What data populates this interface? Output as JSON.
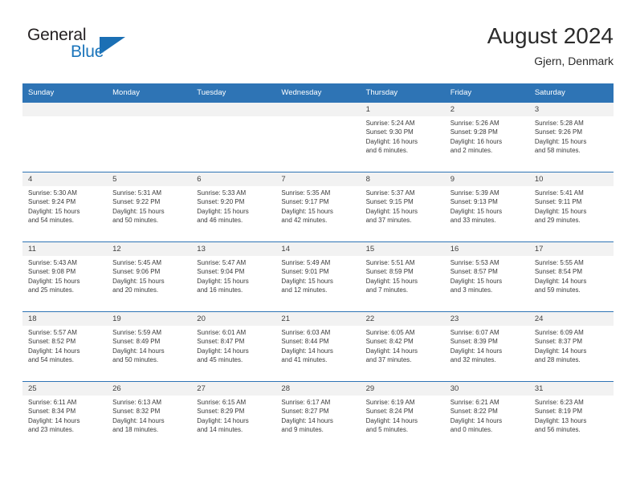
{
  "brand": {
    "word1": "General",
    "word2": "Blue",
    "logo_icon": "blue-triangle-icon",
    "accent_color": "#1b75bb"
  },
  "header": {
    "title": "August 2024",
    "subtitle": "Gjern, Denmark"
  },
  "theme": {
    "header_blue": "#2e74b5",
    "day_band_gray": "#f2f2f2"
  },
  "weekdays": [
    "Sunday",
    "Monday",
    "Tuesday",
    "Wednesday",
    "Thursday",
    "Friday",
    "Saturday"
  ],
  "labels": {
    "sunrise_prefix": "Sunrise:",
    "sunset_prefix": "Sunset:",
    "daylight_prefix": "Daylight:"
  },
  "weeks": [
    [
      {
        "empty": true
      },
      {
        "empty": true
      },
      {
        "empty": true
      },
      {
        "empty": true
      },
      {
        "day": "1",
        "sunrise": "Sunrise: 5:24 AM",
        "sunset": "Sunset: 9:30 PM",
        "daylight1": "Daylight: 16 hours",
        "daylight2": "and 6 minutes."
      },
      {
        "day": "2",
        "sunrise": "Sunrise: 5:26 AM",
        "sunset": "Sunset: 9:28 PM",
        "daylight1": "Daylight: 16 hours",
        "daylight2": "and 2 minutes."
      },
      {
        "day": "3",
        "sunrise": "Sunrise: 5:28 AM",
        "sunset": "Sunset: 9:26 PM",
        "daylight1": "Daylight: 15 hours",
        "daylight2": "and 58 minutes."
      }
    ],
    [
      {
        "day": "4",
        "sunrise": "Sunrise: 5:30 AM",
        "sunset": "Sunset: 9:24 PM",
        "daylight1": "Daylight: 15 hours",
        "daylight2": "and 54 minutes."
      },
      {
        "day": "5",
        "sunrise": "Sunrise: 5:31 AM",
        "sunset": "Sunset: 9:22 PM",
        "daylight1": "Daylight: 15 hours",
        "daylight2": "and 50 minutes."
      },
      {
        "day": "6",
        "sunrise": "Sunrise: 5:33 AM",
        "sunset": "Sunset: 9:20 PM",
        "daylight1": "Daylight: 15 hours",
        "daylight2": "and 46 minutes."
      },
      {
        "day": "7",
        "sunrise": "Sunrise: 5:35 AM",
        "sunset": "Sunset: 9:17 PM",
        "daylight1": "Daylight: 15 hours",
        "daylight2": "and 42 minutes."
      },
      {
        "day": "8",
        "sunrise": "Sunrise: 5:37 AM",
        "sunset": "Sunset: 9:15 PM",
        "daylight1": "Daylight: 15 hours",
        "daylight2": "and 37 minutes."
      },
      {
        "day": "9",
        "sunrise": "Sunrise: 5:39 AM",
        "sunset": "Sunset: 9:13 PM",
        "daylight1": "Daylight: 15 hours",
        "daylight2": "and 33 minutes."
      },
      {
        "day": "10",
        "sunrise": "Sunrise: 5:41 AM",
        "sunset": "Sunset: 9:11 PM",
        "daylight1": "Daylight: 15 hours",
        "daylight2": "and 29 minutes."
      }
    ],
    [
      {
        "day": "11",
        "sunrise": "Sunrise: 5:43 AM",
        "sunset": "Sunset: 9:08 PM",
        "daylight1": "Daylight: 15 hours",
        "daylight2": "and 25 minutes."
      },
      {
        "day": "12",
        "sunrise": "Sunrise: 5:45 AM",
        "sunset": "Sunset: 9:06 PM",
        "daylight1": "Daylight: 15 hours",
        "daylight2": "and 20 minutes."
      },
      {
        "day": "13",
        "sunrise": "Sunrise: 5:47 AM",
        "sunset": "Sunset: 9:04 PM",
        "daylight1": "Daylight: 15 hours",
        "daylight2": "and 16 minutes."
      },
      {
        "day": "14",
        "sunrise": "Sunrise: 5:49 AM",
        "sunset": "Sunset: 9:01 PM",
        "daylight1": "Daylight: 15 hours",
        "daylight2": "and 12 minutes."
      },
      {
        "day": "15",
        "sunrise": "Sunrise: 5:51 AM",
        "sunset": "Sunset: 8:59 PM",
        "daylight1": "Daylight: 15 hours",
        "daylight2": "and 7 minutes."
      },
      {
        "day": "16",
        "sunrise": "Sunrise: 5:53 AM",
        "sunset": "Sunset: 8:57 PM",
        "daylight1": "Daylight: 15 hours",
        "daylight2": "and 3 minutes."
      },
      {
        "day": "17",
        "sunrise": "Sunrise: 5:55 AM",
        "sunset": "Sunset: 8:54 PM",
        "daylight1": "Daylight: 14 hours",
        "daylight2": "and 59 minutes."
      }
    ],
    [
      {
        "day": "18",
        "sunrise": "Sunrise: 5:57 AM",
        "sunset": "Sunset: 8:52 PM",
        "daylight1": "Daylight: 14 hours",
        "daylight2": "and 54 minutes."
      },
      {
        "day": "19",
        "sunrise": "Sunrise: 5:59 AM",
        "sunset": "Sunset: 8:49 PM",
        "daylight1": "Daylight: 14 hours",
        "daylight2": "and 50 minutes."
      },
      {
        "day": "20",
        "sunrise": "Sunrise: 6:01 AM",
        "sunset": "Sunset: 8:47 PM",
        "daylight1": "Daylight: 14 hours",
        "daylight2": "and 45 minutes."
      },
      {
        "day": "21",
        "sunrise": "Sunrise: 6:03 AM",
        "sunset": "Sunset: 8:44 PM",
        "daylight1": "Daylight: 14 hours",
        "daylight2": "and 41 minutes."
      },
      {
        "day": "22",
        "sunrise": "Sunrise: 6:05 AM",
        "sunset": "Sunset: 8:42 PM",
        "daylight1": "Daylight: 14 hours",
        "daylight2": "and 37 minutes."
      },
      {
        "day": "23",
        "sunrise": "Sunrise: 6:07 AM",
        "sunset": "Sunset: 8:39 PM",
        "daylight1": "Daylight: 14 hours",
        "daylight2": "and 32 minutes."
      },
      {
        "day": "24",
        "sunrise": "Sunrise: 6:09 AM",
        "sunset": "Sunset: 8:37 PM",
        "daylight1": "Daylight: 14 hours",
        "daylight2": "and 28 minutes."
      }
    ],
    [
      {
        "day": "25",
        "sunrise": "Sunrise: 6:11 AM",
        "sunset": "Sunset: 8:34 PM",
        "daylight1": "Daylight: 14 hours",
        "daylight2": "and 23 minutes."
      },
      {
        "day": "26",
        "sunrise": "Sunrise: 6:13 AM",
        "sunset": "Sunset: 8:32 PM",
        "daylight1": "Daylight: 14 hours",
        "daylight2": "and 18 minutes."
      },
      {
        "day": "27",
        "sunrise": "Sunrise: 6:15 AM",
        "sunset": "Sunset: 8:29 PM",
        "daylight1": "Daylight: 14 hours",
        "daylight2": "and 14 minutes."
      },
      {
        "day": "28",
        "sunrise": "Sunrise: 6:17 AM",
        "sunset": "Sunset: 8:27 PM",
        "daylight1": "Daylight: 14 hours",
        "daylight2": "and 9 minutes."
      },
      {
        "day": "29",
        "sunrise": "Sunrise: 6:19 AM",
        "sunset": "Sunset: 8:24 PM",
        "daylight1": "Daylight: 14 hours",
        "daylight2": "and 5 minutes."
      },
      {
        "day": "30",
        "sunrise": "Sunrise: 6:21 AM",
        "sunset": "Sunset: 8:22 PM",
        "daylight1": "Daylight: 14 hours",
        "daylight2": "and 0 minutes."
      },
      {
        "day": "31",
        "sunrise": "Sunrise: 6:23 AM",
        "sunset": "Sunset: 8:19 PM",
        "daylight1": "Daylight: 13 hours",
        "daylight2": "and 56 minutes."
      }
    ]
  ]
}
